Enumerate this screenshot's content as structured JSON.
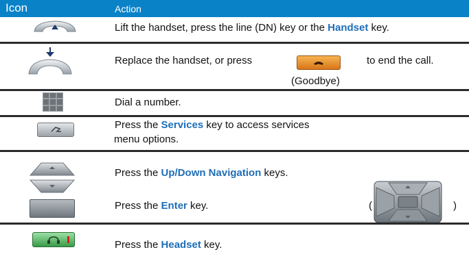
{
  "header": {
    "icon_label": "Icon",
    "action_label": "Action"
  },
  "rows": {
    "offhook": {
      "pre": "Lift the handset, press the line (DN) key or the ",
      "key": "Handset",
      "post": " key."
    },
    "onhook": {
      "pre": "Replace the handset, or press",
      "post": "to end the call.",
      "caption": "(Goodbye)"
    },
    "dial": {
      "text": "Dial a number."
    },
    "services": {
      "pre": "Press the ",
      "key": "Services",
      "post": " key to access services",
      "line2": "menu options."
    },
    "nav": {
      "pre": "Press the ",
      "key": "Up/Down Navigation",
      "post": " keys.",
      "pre2": "Press the ",
      "key2": "Enter",
      "post2": " key.",
      "open_paren": "(",
      "close_paren": ")"
    },
    "headset": {
      "pre": "Press the ",
      "key": "Headset",
      "post": " key."
    }
  },
  "icons": [
    "handset-lift-icon",
    "handset-replace-icon",
    "goodbye-key-icon",
    "keypad-icon",
    "services-key-icon",
    "nav-up-icon",
    "nav-down-icon",
    "enter-key-icon",
    "nav-cluster-icon",
    "headset-key-icon"
  ],
  "colors": {
    "header_bg": "#0a82c8",
    "key_text": "#1e6eb8",
    "goodbye_key": "#e48a1a",
    "headset_key": "#3aa04a"
  }
}
